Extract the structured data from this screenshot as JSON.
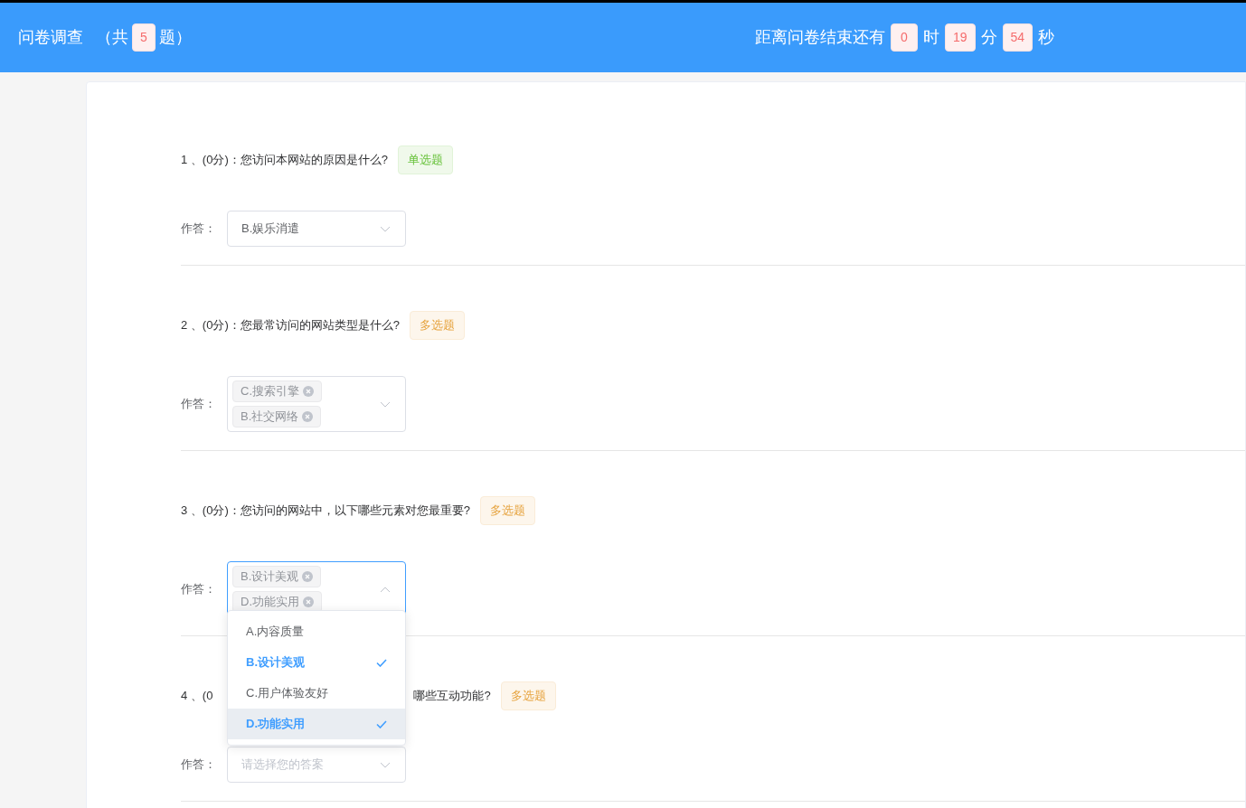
{
  "header": {
    "title": "问卷调查",
    "count_prefix": "（共",
    "count": "5",
    "count_suffix": "题）",
    "timer_label": "距离问卷结束还有",
    "timer": [
      {
        "value": "0",
        "unit": "时"
      },
      {
        "value": "19",
        "unit": "分"
      },
      {
        "value": "54",
        "unit": "秒"
      }
    ]
  },
  "questions": [
    {
      "title_parts": [
        "1 、(0分)：您访问本网站的原因是什么?"
      ],
      "tag": {
        "label": "单选题",
        "kind": "single"
      },
      "answer_label": "作答：",
      "answer": {
        "kind": "single",
        "value": "B.娱乐消遣",
        "open": false
      }
    },
    {
      "title_parts": [
        "2 、(0分)：您最常访问的网站类型是什么?"
      ],
      "tag": {
        "label": "多选题",
        "kind": "multi"
      },
      "answer_label": "作答：",
      "answer": {
        "kind": "multi",
        "values": [
          "C.搜索引擎",
          "B.社交网络"
        ],
        "open": false
      }
    },
    {
      "title_parts": [
        "3 、(0分)：您访问的网站中，以下哪些元素对您最重要?"
      ],
      "tag": {
        "label": "多选题",
        "kind": "multi"
      },
      "answer_label": "作答：",
      "answer": {
        "kind": "multi",
        "values": [
          "B.设计美观",
          "D.功能实用"
        ],
        "open": true,
        "options": [
          {
            "label": "A.内容质量",
            "selected": false,
            "hovered": false
          },
          {
            "label": "B.设计美观",
            "selected": true,
            "hovered": false
          },
          {
            "label": "C.用户体验友好",
            "selected": false,
            "hovered": false
          },
          {
            "label": "D.功能实用",
            "selected": true,
            "hovered": true
          }
        ]
      }
    },
    {
      "title_parts": [
        "4 、(0",
        "哪些互动功能?"
      ],
      "tag": {
        "label": "多选题",
        "kind": "multi"
      },
      "answer_label": "作答：",
      "answer": {
        "kind": "placeholder",
        "placeholder": "请选择您的答案",
        "open": false
      }
    }
  ]
}
